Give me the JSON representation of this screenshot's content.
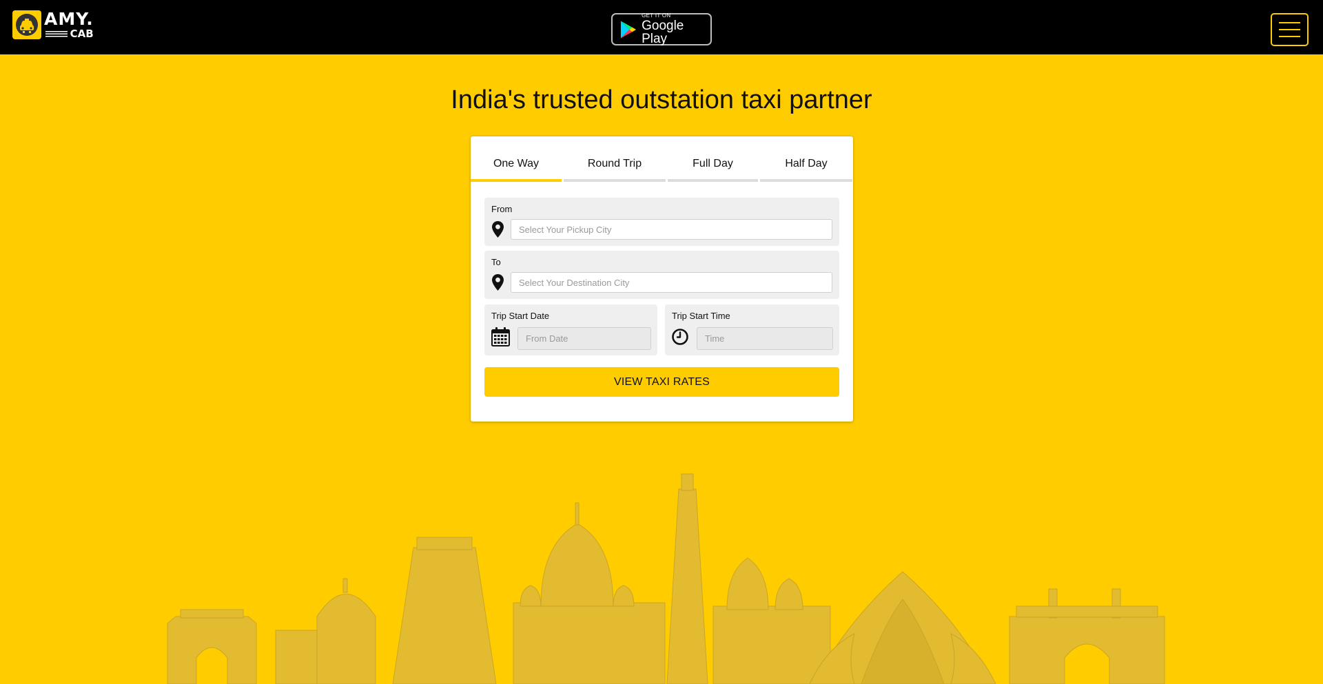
{
  "header": {
    "logo": {
      "name": "AMY.",
      "sub": "CAB"
    },
    "google_play": {
      "small": "GET IT ON",
      "big": "Google Play"
    },
    "menu_icon": "hamburger-icon"
  },
  "hero": {
    "title": "India's trusted outstation taxi partner"
  },
  "booking": {
    "tabs": [
      {
        "label": "One Way",
        "active": true
      },
      {
        "label": "Round Trip",
        "active": false
      },
      {
        "label": "Full Day",
        "active": false
      },
      {
        "label": "Half Day",
        "active": false
      }
    ],
    "from": {
      "label": "From",
      "placeholder": "Select Your Pickup City",
      "icon": "location-pin-icon"
    },
    "to": {
      "label": "To",
      "placeholder": "Select Your Destination City",
      "icon": "location-pin-icon"
    },
    "start_date": {
      "label": "Trip Start Date",
      "placeholder": "From Date",
      "icon": "calendar-icon"
    },
    "start_time": {
      "label": "Trip Start Time",
      "placeholder": "Time",
      "icon": "clock-icon"
    },
    "submit_label": "VIEW TAXI RATES"
  },
  "colors": {
    "brand_yellow": "#ffcc00",
    "header_bg": "#000000",
    "skyline": "#e3bb30"
  }
}
